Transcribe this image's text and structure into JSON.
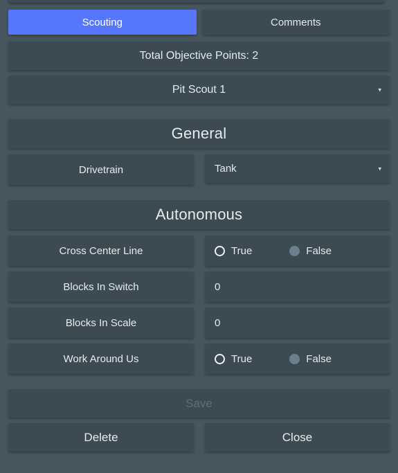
{
  "tabs": [
    {
      "label": "Scouting",
      "active": true
    },
    {
      "label": "Comments",
      "active": false
    }
  ],
  "header": {
    "total_points_label": "Total Objective Points: 2",
    "scout_select_value": "Pit Scout 1",
    "chevron": "▾"
  },
  "sections": {
    "general": {
      "title": "General",
      "rows": [
        {
          "label": "Drivetrain",
          "type": "select",
          "value": "Tank"
        }
      ]
    },
    "autonomous": {
      "title": "Autonomous",
      "rows": [
        {
          "label": "Cross Center Line",
          "type": "radio",
          "options": [
            {
              "label": "True",
              "selected": false,
              "style": "ring"
            },
            {
              "label": "False",
              "selected": true,
              "style": "filled"
            }
          ]
        },
        {
          "label": "Blocks In Switch",
          "type": "number",
          "value": "0"
        },
        {
          "label": "Blocks In Scale",
          "type": "number",
          "value": "0"
        },
        {
          "label": "Work Around Us",
          "type": "radio",
          "options": [
            {
              "label": "True",
              "selected": false,
              "style": "ring"
            },
            {
              "label": "False",
              "selected": true,
              "style": "filled"
            }
          ]
        }
      ]
    }
  },
  "actions": {
    "save_label": "Save",
    "save_disabled": true,
    "delete_label": "Delete",
    "close_label": "Close"
  },
  "colors": {
    "background": "#47555e",
    "panel": "#3c4a52",
    "accent": "#5677fb",
    "text": "#e6ebee",
    "text_disabled": "#5d6f79",
    "radio_filled": "#6b7f8c"
  }
}
